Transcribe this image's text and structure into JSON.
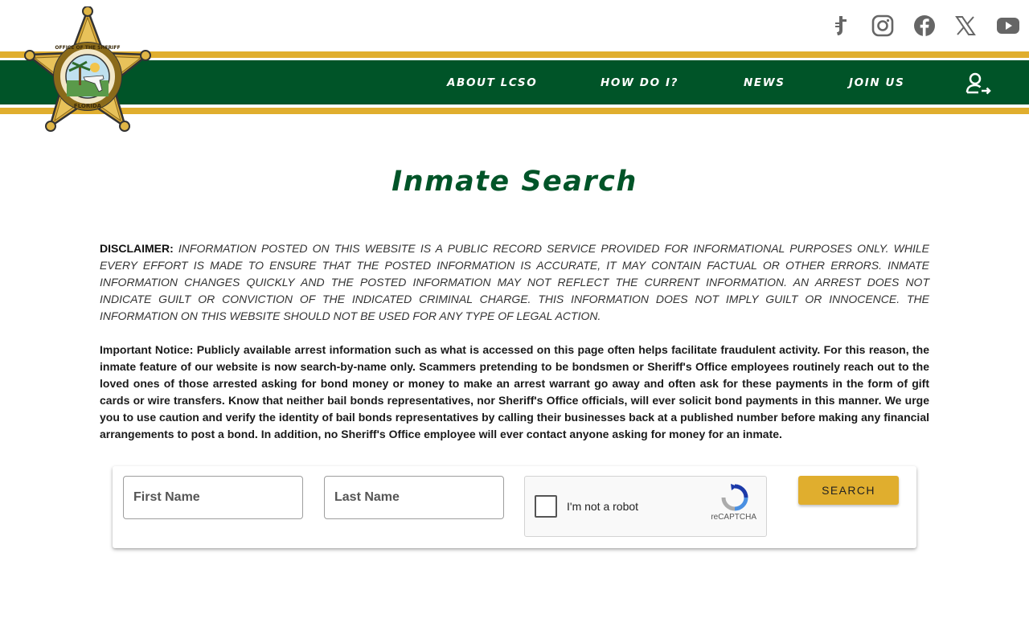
{
  "header": {
    "logo": {
      "top_text": "OFFICE OF THE SHERIFF",
      "county": "LAKE COUNTY",
      "state": "FLORIDA",
      "icon": "sheriff-star-badge"
    },
    "social": [
      {
        "name": "tiktok",
        "icon": "tiktok-icon"
      },
      {
        "name": "instagram",
        "icon": "instagram-icon"
      },
      {
        "name": "facebook",
        "icon": "facebook-icon"
      },
      {
        "name": "x",
        "icon": "x-icon"
      },
      {
        "name": "youtube",
        "icon": "youtube-icon"
      }
    ],
    "nav": [
      {
        "label": "ABOUT LCSO"
      },
      {
        "label": "HOW DO I?"
      },
      {
        "label": "NEWS"
      },
      {
        "label": "JOIN US"
      }
    ],
    "login_icon": "user-login-icon"
  },
  "page": {
    "title": "Inmate Search",
    "disclaimer_label": "DISCLAIMER:",
    "disclaimer_text": "INFORMATION POSTED ON THIS WEBSITE IS A PUBLIC RECORD SERVICE PROVIDED FOR INFORMATIONAL PURPOSES ONLY. WHILE EVERY EFFORT IS MADE TO ENSURE THAT THE POSTED INFORMATION IS ACCURATE, IT MAY CONTAIN FACTUAL OR OTHER ERRORS. INMATE INFORMATION CHANGES QUICKLY AND THE POSTED INFORMATION MAY NOT REFLECT THE CURRENT INFORMATION. AN ARREST DOES NOT INDICATE GUILT OR CONVICTION OF THE INDICATED CRIMINAL CHARGE. THIS INFORMATION DOES NOT IMPLY GUILT OR INNOCENCE. THE INFORMATION ON THIS WEBSITE SHOULD NOT BE USED FOR ANY TYPE OF LEGAL ACTION.",
    "notice_text": "Important Notice: Publicly available arrest information such as what is accessed on this page often helps facilitate fraudulent activity. For this reason, the inmate feature of our website is now search-by-name only. Scammers pretending to be bondsmen or Sheriff's Office employees routinely reach out to the loved ones of those arrested asking for bond money or money to make an arrest warrant go away and often ask for these payments in the form of gift cards or wire transfers. Know that neither bail bonds representatives, nor Sheriff's Office officials, will ever solicit bond payments in this manner. We urge you to use caution and verify the identity of bail bonds representatives by calling their businesses back at a published number before making any financial arrangements to post a bond. In addition, no Sheriff's Office employee will ever contact anyone asking for money for an inmate."
  },
  "search_form": {
    "first_name": {
      "placeholder": "First Name",
      "value": ""
    },
    "last_name": {
      "placeholder": "Last Name",
      "value": ""
    },
    "recaptcha": {
      "label": "I'm not a robot",
      "brand": "reCAPTCHA",
      "checked": false
    },
    "submit_label": "SEARCH"
  },
  "colors": {
    "green": "#005428",
    "gold": "#e0ae2e",
    "icon_gray": "#666666"
  }
}
